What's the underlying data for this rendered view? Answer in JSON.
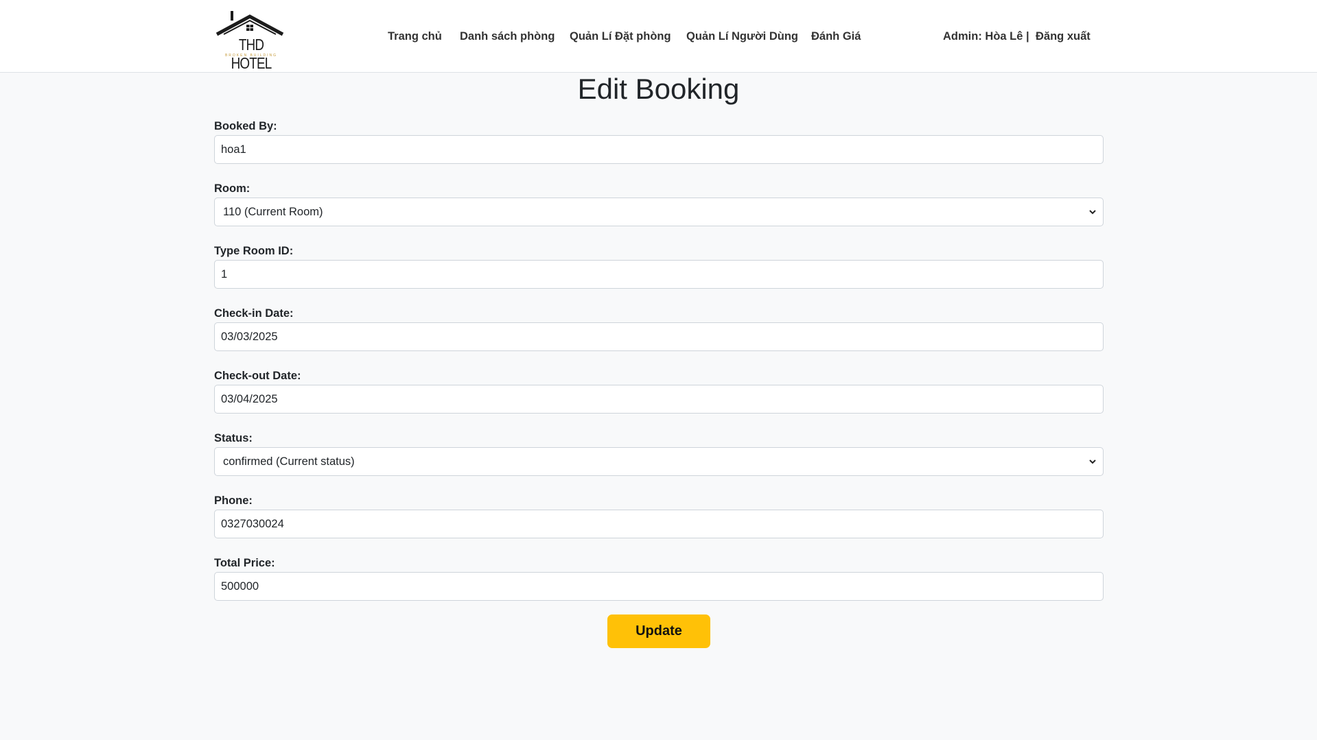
{
  "brand": {
    "name": "THD HOTEL",
    "tagline": "BROKEN BUILDING"
  },
  "nav": {
    "items": [
      "Trang chủ",
      "Danh sách phòng",
      "Quản Lí Đặt phòng",
      "Quản Lí Người Dùng",
      "Đánh Giá"
    ],
    "admin_label": "Admin: Hòa Lê |",
    "logout_label": "Đăng xuất"
  },
  "page": {
    "title": "Edit Booking"
  },
  "form": {
    "booked_by": {
      "label": "Booked By:",
      "value": "hoa1"
    },
    "room": {
      "label": "Room:",
      "value": "110 (Current Room)"
    },
    "type_room_id": {
      "label": "Type Room ID:",
      "value": "1"
    },
    "check_in": {
      "label": "Check-in Date:",
      "value": "03/03/2025"
    },
    "check_out": {
      "label": "Check-out Date:",
      "value": "03/04/2025"
    },
    "status": {
      "label": "Status:",
      "value": "confirmed (Current status)"
    },
    "phone": {
      "label": "Phone:",
      "value": "0327030024"
    },
    "total_price": {
      "label": "Total Price:",
      "value": "500000"
    },
    "update_label": "Update"
  },
  "colors": {
    "accent": "#ffc107",
    "background": "#f8f9fa",
    "header": "#ffffff"
  }
}
